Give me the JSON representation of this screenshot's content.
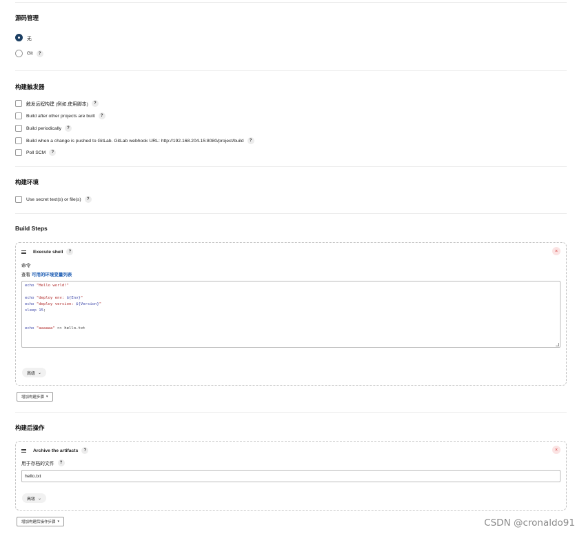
{
  "scm": {
    "title": "源码管理",
    "options": [
      {
        "label": "无",
        "checked": true
      },
      {
        "label": "Git",
        "help": "?"
      }
    ]
  },
  "triggers": {
    "title": "构建触发器",
    "options": [
      {
        "label": "触发远程构建 (例如,使用脚本)",
        "help": "?"
      },
      {
        "label": "Build after other projects are built",
        "help": "?"
      },
      {
        "label": "Build periodically",
        "help": "?"
      },
      {
        "label": "Build when a change is pushed to GitLab. GitLab webhook URL: http://192.168.204.15:8080/project/build",
        "help": "?"
      },
      {
        "label": "Poll SCM",
        "help": "?"
      }
    ]
  },
  "environment": {
    "title": "构建环境",
    "options": [
      {
        "label": "Use secret text(s) or file(s)",
        "help": "?"
      }
    ]
  },
  "build_steps": {
    "title": "Build Steps",
    "step": {
      "title": "Execute shell",
      "help": "?",
      "close": "×",
      "command_label": "命令",
      "view_prefix": "查看",
      "view_link": "可用的环境变量列表",
      "script_lines": [
        "echo \"Hello world!\"",
        "",
        "echo \"deploy env: ${Env}\"",
        "echo \"deploy version: ${Version}\"",
        "sleep 15;",
        "",
        "",
        "echo \"aaaaaa\" >> hello.txt"
      ],
      "advanced_label": "高级"
    },
    "add_button": "增加构建步骤"
  },
  "post_build": {
    "title": "构建后操作",
    "step": {
      "title": "Archive the artifacts",
      "help": "?",
      "close": "×",
      "files_label": "用于存档的文件",
      "files_value": "hello.txt",
      "advanced_label": "高级"
    },
    "add_button": "增加构建后操作步骤"
  },
  "icons": {
    "drag": "drag-handle-icon",
    "close": "close-icon",
    "help": "help-icon",
    "chevron": "chevron-down-icon"
  },
  "watermark": "CSDN @cronaldo91",
  "colors": {
    "radio_checked": "#1c3f63",
    "link": "#1c5cb3",
    "close_bg": "#fbe3e3",
    "close_fg": "#d43b3b"
  }
}
